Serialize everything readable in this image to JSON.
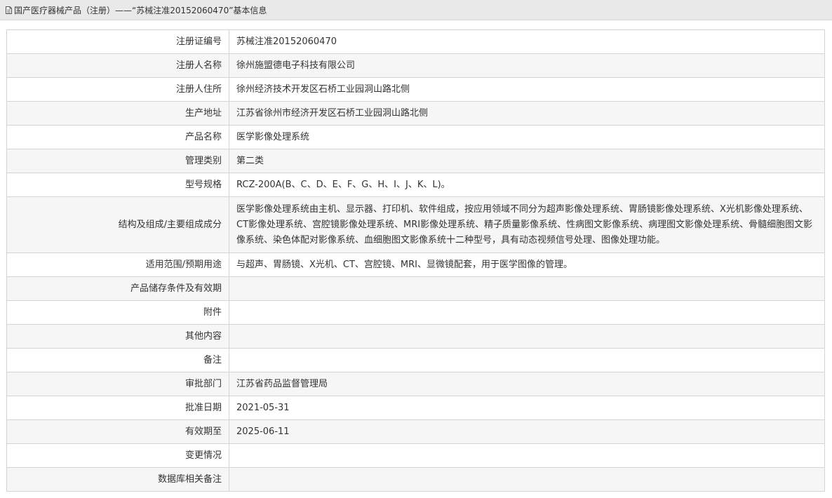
{
  "header": {
    "title": "国产医疗器械产品（注册）——“苏械注准20152060470”基本信息",
    "icon": "document-icon"
  },
  "rows": [
    {
      "label": "注册证编号",
      "value": "苏械注准20152060470"
    },
    {
      "label": "注册人名称",
      "value": "徐州施盟德电子科技有限公司"
    },
    {
      "label": "注册人住所",
      "value": "徐州经济技术开发区石桥工业园洞山路北侧"
    },
    {
      "label": "生产地址",
      "value": "江苏省徐州市经济开发区石桥工业园洞山路北侧"
    },
    {
      "label": "产品名称",
      "value": "医学影像处理系统"
    },
    {
      "label": "管理类别",
      "value": "第二类"
    },
    {
      "label": "型号规格",
      "value": "RCZ-200A(B、C、D、E、F、G、H、I、J、K、L)。"
    },
    {
      "label": "结构及组成/主要组成成分",
      "value": "医学影像处理系统由主机、显示器、打印机、软件组成，按应用领域不同分为超声影像处理系统、胃肠镜影像处理系统、X光机影像处理系统、CT影像处理系统、宫腔镜影像处理系统、MRI影像处理系统、精子质量影像系统、性病图文影像系统、病理图文影像处理系统、骨髓细胞图文影像系统、染色体配对影像系统、血细胞图文影像系统十二种型号，具有动态视频信号处理、图像处理功能。"
    },
    {
      "label": "适用范围/预期用途",
      "value": "与超声、胃肠镜、X光机、CT、宫腔镜、MRI、显微镜配套，用于医学图像的管理。"
    },
    {
      "label": "产品储存条件及有效期",
      "value": ""
    },
    {
      "label": "附件",
      "value": ""
    },
    {
      "label": "其他内容",
      "value": ""
    },
    {
      "label": "备注",
      "value": ""
    },
    {
      "label": "审批部门",
      "value": "江苏省药品监督管理局"
    },
    {
      "label": "批准日期",
      "value": "2021-05-31"
    },
    {
      "label": "有效期至",
      "value": "2025-06-11"
    },
    {
      "label": "变更情况",
      "value": ""
    },
    {
      "label": "数据库相关备注",
      "value": ""
    }
  ]
}
